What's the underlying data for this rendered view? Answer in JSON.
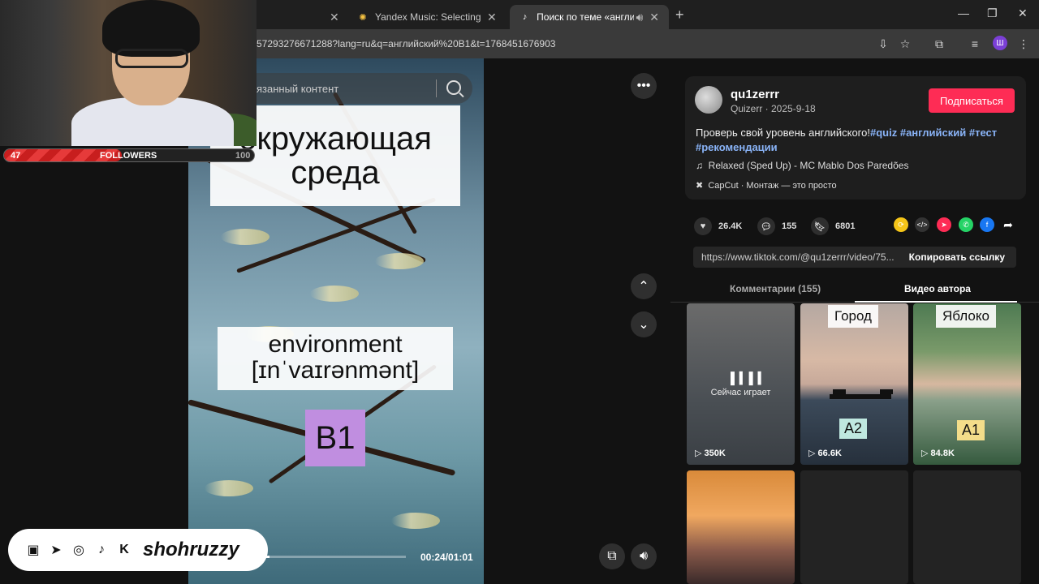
{
  "browser": {
    "tabs": [
      {
        "title": "",
        "active": false
      },
      {
        "title": "Yandex Music: Selecting music",
        "active": false
      },
      {
        "title": "Поиск по теме «английск",
        "active": true
      }
    ],
    "url": "57293276671288?lang=ru&q=английский%20B1&t=1768451676903"
  },
  "stream_overlay": {
    "followers_current": "47",
    "followers_label": "FOLLOWERS",
    "followers_goal": "100",
    "progress_fraction": 0.47,
    "handle": "shohruzzy"
  },
  "video": {
    "search_placeholder": "язанный контент",
    "word_ru": "окружающая среда",
    "word_en": "environment",
    "transcription": "[ɪnˈvaɪrənmənt]",
    "level": "B1",
    "timecode": "00:24/01:01",
    "progress_fraction": 0.2
  },
  "post": {
    "author": "qu1zerrr",
    "meta": "Quizerr · 2025-9-18",
    "subscribe_label": "Подписаться",
    "description_text": "Проверь свой уровень английского!",
    "tags": [
      "#quiz",
      "#английский",
      "#тест",
      "#рекомендации"
    ],
    "music": "Relaxed (Sped Up) - MC Mablo Dos Paredões",
    "capcut": "CapCut · Монтаж — это просто",
    "likes": "26.4K",
    "comments": "155",
    "saves": "6801",
    "link": "https://www.tiktok.com/@qu1zerrr/video/75...",
    "copy_label": "Копировать ссылку",
    "tab_comments": "Комментарии (155)",
    "tab_author_videos": "Видео автора"
  },
  "thumbnails": [
    {
      "caption": "Сейчас играет",
      "views": "350K",
      "label": "",
      "level": ""
    },
    {
      "caption": "",
      "views": "66.6K",
      "label": "Город",
      "level": "A2"
    },
    {
      "caption": "",
      "views": "84.8K",
      "label": "Яблоко",
      "level": "A1"
    }
  ],
  "colors": {
    "accent": "#fe2c55",
    "level_b1": "#c08ee0",
    "level_a2": "#bfe8e0",
    "level_a1": "#f4dd8a"
  }
}
